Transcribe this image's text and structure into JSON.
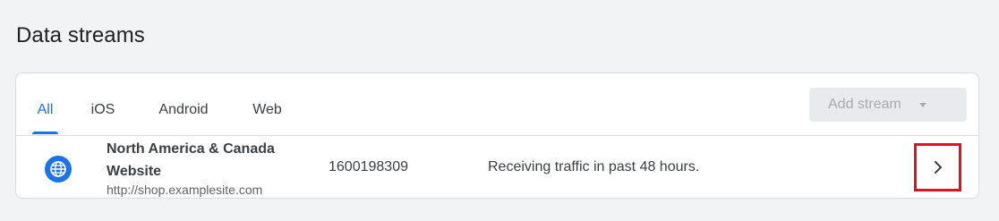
{
  "page": {
    "title": "Data streams"
  },
  "tabs": [
    {
      "label": "All",
      "active": true
    },
    {
      "label": "iOS",
      "active": false
    },
    {
      "label": "Android",
      "active": false
    },
    {
      "label": "Web",
      "active": false
    }
  ],
  "toolbar": {
    "add_stream_label": "Add stream",
    "add_stream_disabled": true
  },
  "streams": [
    {
      "icon": "globe-icon",
      "name": "North America & Canada Website",
      "url": "http://shop.examplesite.com",
      "id": "1600198309",
      "status": "Receiving traffic in past 48 hours.",
      "action_icon": "chevron-right-icon"
    }
  ],
  "colors": {
    "accent": "#1a73e8",
    "highlight_border": "#e0121c",
    "page_background": "#f1f3f4"
  }
}
